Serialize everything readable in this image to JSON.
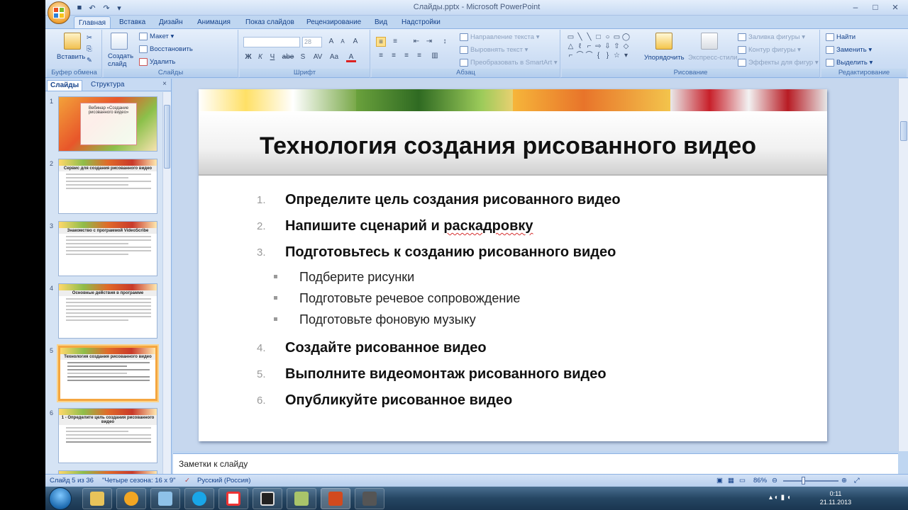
{
  "window": {
    "title": "Слайды.pptx - Microsoft PowerPoint",
    "minimize": "–",
    "maximize": "□",
    "close": "×"
  },
  "qat": {
    "save": "■",
    "undo": "↶",
    "redo": "↷",
    "customize": "▾"
  },
  "tabs": [
    "Главная",
    "Вставка",
    "Дизайн",
    "Анимация",
    "Показ слайдов",
    "Рецензирование",
    "Вид",
    "Надстройки"
  ],
  "ribbon": {
    "clipboard": {
      "label": "Буфер обмена",
      "paste": "Вставить"
    },
    "slides": {
      "label": "Слайды",
      "new_slide": "Создать слайд",
      "layout": "Макет",
      "reset": "Восстановить",
      "delete": "Удалить"
    },
    "font": {
      "label": "Шрифт",
      "size": "28",
      "bold": "Ж",
      "italic": "К",
      "underline": "Ч",
      "strike": "abe",
      "shadow": "S",
      "spacing": "AV",
      "case": "Aa",
      "grow": "A",
      "shrink": "A",
      "clear": "A",
      "color": "A"
    },
    "paragraph": {
      "label": "Абзац",
      "text_direction": "Направление текста",
      "align_text": "Выровнять текст",
      "smartart": "Преобразовать в SmartArt"
    },
    "drawing": {
      "label": "Рисование",
      "arrange": "Упорядочить",
      "quick_styles": "Экспресс-стили",
      "fill": "Заливка фигуры",
      "outline": "Контур фигуры",
      "effects": "Эффекты для фигур",
      "shapes": [
        "▭",
        "╲",
        "╲",
        "□",
        "○",
        "▭",
        "◯",
        "△",
        "ℓ",
        "⌐",
        "⇨",
        "⇩",
        "⇧",
        "◇",
        "⌐",
        "⌒",
        "⌒",
        "{",
        "}",
        "☆",
        "▾"
      ]
    },
    "editing": {
      "label": "Редактирование",
      "find": "Найти",
      "replace": "Заменить",
      "select": "Выделить"
    }
  },
  "panel": {
    "tab_slides": "Слайды",
    "tab_outline": "Структура",
    "close": "×",
    "thumbs": [
      {
        "num": "1",
        "title": "Вебинар «Создание рисованного видео»"
      },
      {
        "num": "2",
        "title": "Сервис для создания рисованного видео"
      },
      {
        "num": "3",
        "title": "Знакомство с программой VideoScribe"
      },
      {
        "num": "4",
        "title": "Основные действия в программе"
      },
      {
        "num": "5",
        "title": "Технология создания рисованного видео"
      },
      {
        "num": "6",
        "title": "1 - Определите цель создания рисованного видео"
      }
    ]
  },
  "slide": {
    "title": "Технология создания рисованного видео",
    "items": [
      {
        "num": "1.",
        "text": "Определите цель создания рисованного видео"
      },
      {
        "num": "2.",
        "text_a": "Напишите сценарий и ",
        "text_b": "раскадровку"
      },
      {
        "num": "3.",
        "text": "Подготовьтесь к созданию рисованного видео"
      },
      {
        "num": "4.",
        "text": "Создайте рисованное видео"
      },
      {
        "num": "5.",
        "text": "Выполните видеомонтаж рисованного видео"
      },
      {
        "num": "6.",
        "text": "Опубликуйте рисованное видео"
      }
    ],
    "subitems": [
      "Подберите рисунки",
      "Подготовьте речевое сопровождение",
      "Подготовьте фоновую музыку"
    ]
  },
  "notes": {
    "placeholder": "Заметки к слайду"
  },
  "status": {
    "slide": "Слайд 5 из 36",
    "theme": "\"Четыре сезона: 16 x 9\"",
    "language": "Русский (Россия)",
    "zoom": "86%"
  },
  "tray": {
    "time": "0:11",
    "date": "21.11.2013"
  },
  "colors": {
    "ribbon": "#d0e0f5",
    "accent": "#15428b",
    "selected_thumb": "#f4a640"
  }
}
